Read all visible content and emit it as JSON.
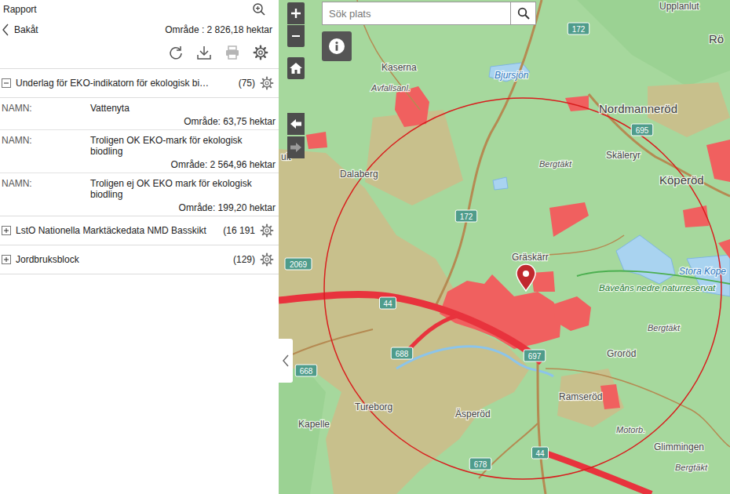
{
  "panel": {
    "title": "Rapport",
    "back": "Bakåt",
    "area": "Område : 2 826,18 hektar",
    "toolbar": [
      {
        "kind": "refresh",
        "disabled": false
      },
      {
        "kind": "download",
        "disabled": false
      },
      {
        "kind": "print",
        "disabled": true
      },
      {
        "kind": "settings",
        "disabled": false
      }
    ],
    "layers": [
      {
        "title": "Underlag för EKO-indikatorn för ekologisk bi…",
        "count": "(75)",
        "expanded": true,
        "features": [
          {
            "label": "NAMN:",
            "value": "Vattenyta",
            "area": "Område: 63,75 hektar"
          },
          {
            "label": "NAMN:",
            "value": "Troligen OK EKO-mark för ekologisk biodling",
            "area": "Område: 2 564,96 hektar"
          },
          {
            "label": "NAMN:",
            "value": "Troligen ej OK EKO mark för ekologisk biodling",
            "area": "Område: 199,20 hektar"
          }
        ]
      },
      {
        "title": "LstO Nationella Marktäckedata NMD Basskikt",
        "count": "(16 191",
        "expanded": false,
        "features": []
      },
      {
        "title": "Jordbruksblock",
        "count": "(129)",
        "expanded": false,
        "features": []
      }
    ]
  },
  "map": {
    "search": {
      "placeholder": "Sök plats"
    },
    "labels": [
      {
        "text": "Upplanlut",
        "kind": "place"
      },
      {
        "text": "Rö",
        "kind": "town"
      },
      {
        "text": "Kaserna",
        "kind": "place"
      },
      {
        "text": "Avfallsanl.",
        "kind": "feature"
      },
      {
        "text": "Bjursjön",
        "kind": "water"
      },
      {
        "text": "172",
        "kind": "road"
      },
      {
        "text": "Nordmanneröd",
        "kind": "town"
      },
      {
        "text": "695",
        "kind": "road"
      },
      {
        "text": "Bergtäkt",
        "kind": "feature"
      },
      {
        "text": "Skäleryr",
        "kind": "place"
      },
      {
        "text": "Köperöd",
        "kind": "town"
      },
      {
        "text": "Dalaberg",
        "kind": "place"
      },
      {
        "text": "ult",
        "kind": "place"
      },
      {
        "text": "172",
        "kind": "road"
      },
      {
        "text": "2069",
        "kind": "road"
      },
      {
        "text": "Gräskärr",
        "kind": "place"
      },
      {
        "text": "Stora Kope",
        "kind": "water"
      },
      {
        "text": "Bäveåns nedre naturreservat",
        "kind": "nature"
      },
      {
        "text": "44",
        "kind": "road"
      },
      {
        "text": "Bergtäkt",
        "kind": "feature"
      },
      {
        "text": "688",
        "kind": "road"
      },
      {
        "text": "697",
        "kind": "road"
      },
      {
        "text": "Groröd",
        "kind": "place"
      },
      {
        "text": "668",
        "kind": "road"
      },
      {
        "text": "Ramseröd",
        "kind": "place"
      },
      {
        "text": "Tureborg",
        "kind": "place"
      },
      {
        "text": "Äsperöd",
        "kind": "place"
      },
      {
        "text": "Kapelle",
        "kind": "place"
      },
      {
        "text": "Motorb.",
        "kind": "feature"
      },
      {
        "text": "Glimmingen",
        "kind": "place"
      },
      {
        "text": "44",
        "kind": "road"
      },
      {
        "text": "678",
        "kind": "road"
      },
      {
        "text": "Bergtäkt",
        "kind": "feature"
      }
    ]
  }
}
